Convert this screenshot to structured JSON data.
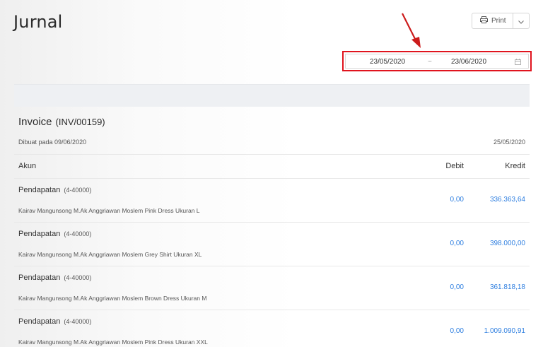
{
  "header": {
    "title": "Jurnal",
    "print_label": "Print",
    "print_icon": "printer-icon",
    "dropdown_icon": "chevron-down-icon"
  },
  "date_range": {
    "start": "23/05/2020",
    "separator": "~",
    "end": "23/06/2020",
    "icon": "calendar-icon",
    "highlight_color": "#e0141e"
  },
  "invoice": {
    "label": "Invoice",
    "number": "(INV/00159)",
    "created": "Dibuat pada 09/06/2020",
    "date": "25/05/2020"
  },
  "table": {
    "headers": {
      "akun": "Akun",
      "debit": "Debit",
      "kredit": "Kredit"
    },
    "rows": [
      {
        "account": "Pendapatan",
        "code": "(4-40000)",
        "description": "Kairav Mangunsong M.Ak Anggriawan Moslem Pink Dress Ukuran L",
        "debit": "0,00",
        "kredit": "336.363,64"
      },
      {
        "account": "Pendapatan",
        "code": "(4-40000)",
        "description": "Kairav Mangunsong M.Ak Anggriawan Moslem Grey Shirt Ukuran XL",
        "debit": "0,00",
        "kredit": "398.000,00"
      },
      {
        "account": "Pendapatan",
        "code": "(4-40000)",
        "description": "Kairav Mangunsong M.Ak Anggriawan Moslem Brown Dress Ukuran M",
        "debit": "0,00",
        "kredit": "361.818,18"
      },
      {
        "account": "Pendapatan",
        "code": "(4-40000)",
        "description": "Kairav Mangunsong M.Ak Anggriawan Moslem Pink Dress Ukuran XXL",
        "debit": "0,00",
        "kredit": "1.009.090,91"
      }
    ]
  },
  "colors": {
    "amount": "#2f7fe0",
    "annotation_arrow": "#cc1b1b"
  }
}
